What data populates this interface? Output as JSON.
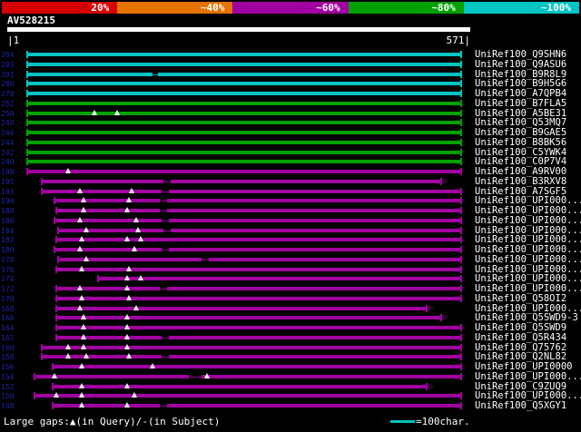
{
  "scale": {
    "segments": [
      {
        "label": "20%",
        "color": "#d40000"
      },
      {
        "label": "~40%",
        "color": "#e67300"
      },
      {
        "label": "~60%",
        "color": "#a100a1"
      },
      {
        "label": "~80%",
        "color": "#00a100"
      },
      {
        "label": "~100%",
        "color": "#00c3c3"
      }
    ]
  },
  "query": {
    "name": "AV528215",
    "start_label": "|1",
    "end_label": "571|"
  },
  "colors": {
    "cyan": "#00c3c3",
    "green": "#00a100",
    "magenta": "#a100a1"
  },
  "legend": {
    "gaps": "Large gaps:▲(in Query)/-(in Subject)",
    "scale_equals": "=100char.",
    "scale_color": "#00c3c3"
  },
  "rows": [
    {
      "id": "UniRef100_Q9SHN6",
      "score": "284",
      "color": "cyan",
      "start": 30,
      "end": 508
    },
    {
      "id": "UniRef100_Q9ASU6",
      "score": "283",
      "color": "cyan",
      "start": 30,
      "end": 508
    },
    {
      "id": "UniRef100_B9R8L9",
      "score": "281",
      "color": "cyan",
      "start": 30,
      "end": 508,
      "gaps": [
        [
          168,
          174
        ]
      ]
    },
    {
      "id": "UniRef100_B9H5G6",
      "score": "280",
      "color": "cyan",
      "start": 30,
      "end": 508
    },
    {
      "id": "UniRef100_A7QPB4",
      "score": "278",
      "color": "cyan",
      "start": 30,
      "end": 508
    },
    {
      "id": "UniRef100_B7FLA5",
      "score": "252",
      "color": "green",
      "start": 30,
      "end": 508
    },
    {
      "id": "UniRef100_A5BE31",
      "score": "250",
      "color": "green",
      "start": 30,
      "end": 508,
      "tris": [
        104,
        129
      ]
    },
    {
      "id": "UniRef100_Q53MQ7",
      "score": "248",
      "color": "green",
      "start": 30,
      "end": 508
    },
    {
      "id": "UniRef100_B9GAE5",
      "score": "246",
      "color": "green",
      "start": 30,
      "end": 508
    },
    {
      "id": "UniRef100_B8BK56",
      "score": "244",
      "color": "green",
      "start": 30,
      "end": 508
    },
    {
      "id": "UniRef100_C5YWK4",
      "score": "242",
      "color": "green",
      "start": 30,
      "end": 508
    },
    {
      "id": "UniRef100_C0P7V4",
      "score": "240",
      "color": "green",
      "start": 30,
      "end": 508
    },
    {
      "id": "UniRef100_A9RV00",
      "score": "198",
      "color": "magenta",
      "start": 30,
      "end": 508,
      "tris": [
        75
      ]
    },
    {
      "id": "UniRef100_B3RXV8",
      "score": "195",
      "color": "magenta",
      "start": 46,
      "end": 486,
      "arrow": true,
      "gaps": [
        [
          180,
          188
        ]
      ]
    },
    {
      "id": "UniRef100_A7SGF5",
      "score": "193",
      "color": "magenta",
      "start": 46,
      "end": 508,
      "tris": [
        88,
        145
      ],
      "gaps": [
        [
          178,
          186
        ]
      ]
    },
    {
      "id": "UniRef100_UPI000...",
      "score": "190",
      "color": "magenta",
      "start": 60,
      "end": 508,
      "tris": [
        92,
        142
      ],
      "gaps": [
        [
          176,
          184
        ]
      ]
    },
    {
      "id": "UniRef100_UPI000...",
      "score": "188",
      "color": "magenta",
      "start": 62,
      "end": 508,
      "tris": [
        92,
        140
      ],
      "gaps": [
        [
          176,
          184
        ]
      ]
    },
    {
      "id": "UniRef100_UPI000...",
      "score": "186",
      "color": "magenta",
      "start": 60,
      "end": 508,
      "tris": [
        88,
        150
      ],
      "gaps": [
        [
          178,
          186
        ]
      ]
    },
    {
      "id": "UniRef100_UPI000...",
      "score": "184",
      "color": "magenta",
      "start": 64,
      "end": 508,
      "tris": [
        95,
        152
      ],
      "gaps": [
        [
          180,
          188
        ]
      ]
    },
    {
      "id": "UniRef100_UPI000...",
      "score": "182",
      "color": "magenta",
      "start": 62,
      "end": 508,
      "tris": [
        90,
        140,
        155
      ]
    },
    {
      "id": "UniRef100_UPI000...",
      "score": "180",
      "color": "magenta",
      "start": 60,
      "end": 508,
      "tris": [
        88,
        148
      ],
      "gaps": [
        [
          178,
          186
        ]
      ]
    },
    {
      "id": "UniRef100_UPI000...",
      "score": "178",
      "color": "magenta",
      "start": 64,
      "end": 508,
      "tris": [
        95
      ],
      "gaps": [
        [
          222,
          230
        ]
      ]
    },
    {
      "id": "UniRef100_UPI000...",
      "score": "176",
      "color": "magenta",
      "start": 62,
      "end": 508,
      "tris": [
        90,
        142
      ]
    },
    {
      "id": "UniRef100_UPI000...",
      "score": "174",
      "color": "magenta",
      "start": 108,
      "end": 508,
      "tris": [
        140,
        155
      ]
    },
    {
      "id": "UniRef100_UPI000...",
      "score": "172",
      "color": "magenta",
      "start": 62,
      "end": 508,
      "tris": [
        88,
        140
      ],
      "gaps": [
        [
          176,
          184
        ]
      ]
    },
    {
      "id": "UniRef100_Q58OI2",
      "score": "170",
      "color": "magenta",
      "start": 62,
      "end": 508,
      "tris": [
        90,
        142
      ]
    },
    {
      "id": "UniRef100_UPI000...",
      "score": "168",
      "color": "magenta",
      "start": 62,
      "end": 470,
      "arrow": true,
      "tris": [
        88,
        150
      ]
    },
    {
      "id": "UniRef100_Q5SWD9-3",
      "score": "166",
      "color": "magenta",
      "start": 62,
      "end": 486,
      "arrow": true,
      "tris": [
        92,
        140
      ]
    },
    {
      "id": "UniRef100_Q5SWD9",
      "score": "164",
      "color": "magenta",
      "start": 62,
      "end": 508,
      "tris": [
        92,
        140
      ]
    },
    {
      "id": "UniRef100_Q5R434",
      "score": "162",
      "color": "magenta",
      "start": 62,
      "end": 508,
      "tris": [
        92,
        140
      ],
      "gaps": [
        [
          178,
          186
        ]
      ]
    },
    {
      "id": "UniRef100_Q75762",
      "score": "160",
      "color": "magenta",
      "start": 46,
      "end": 508,
      "tris": [
        75,
        92,
        140
      ]
    },
    {
      "id": "UniRef100_Q2NL82",
      "score": "158",
      "color": "magenta",
      "start": 46,
      "end": 508,
      "tris": [
        75,
        95,
        142
      ],
      "gaps": [
        [
          178,
          186
        ]
      ]
    },
    {
      "id": "UniRef100_UPI0000",
      "score": "156",
      "color": "magenta",
      "start": 58,
      "end": 508,
      "tris": [
        90,
        168
      ]
    },
    {
      "id": "UniRef100_UPI000...",
      "score": "154",
      "color": "magenta",
      "start": 38,
      "end": 508,
      "tris": [
        60,
        228
      ],
      "gaps": [
        [
          208,
          222
        ]
      ]
    },
    {
      "id": "UniRef100_C9ZUQ9",
      "score": "152",
      "color": "magenta",
      "start": 58,
      "end": 470,
      "arrow": true,
      "tris": [
        90,
        140
      ]
    },
    {
      "id": "UniRef100_UPI000...",
      "score": "150",
      "color": "magenta",
      "start": 38,
      "end": 508,
      "tris": [
        62,
        90,
        148
      ]
    },
    {
      "id": "UniRef100_Q5XGY1",
      "score": "148",
      "color": "magenta",
      "start": 58,
      "end": 508,
      "tris": [
        90,
        140
      ],
      "gaps": [
        [
          176,
          184
        ]
      ]
    }
  ]
}
